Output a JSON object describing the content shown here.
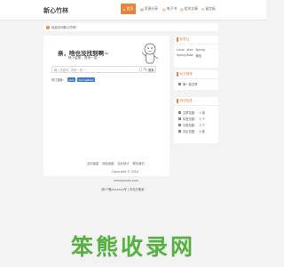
{
  "header": {
    "logo": "新心竹林",
    "nav": [
      {
        "label": "首页",
        "icon": "home-icon"
      },
      {
        "label": "资源分享",
        "icon": "share-icon"
      },
      {
        "label": "电子书",
        "icon": "book-icon"
      },
      {
        "label": "相关文章",
        "icon": "article-icon"
      },
      {
        "label": "留言板",
        "icon": "message-icon"
      }
    ]
  },
  "notice": {
    "text": "欢迎访问新心竹林！"
  },
  "hero": {
    "title": "亲，啥也没找到啊~",
    "subtitle": "换个姿势，再来一发~",
    "search_placeholder": "输入关键词，再来一发~~",
    "search_button": "搜索",
    "hot_label": "热门搜索：",
    "hot_tags": [
      "Java",
      "SpringBoot"
    ]
  },
  "sidebar": {
    "tags_title": "标签云",
    "tags": [
      "Linux",
      "Java",
      "Spring",
      "Spring Boot",
      "微信"
    ],
    "recommend_title": "站长推荐",
    "recommend_items": [
      "第一篇文章"
    ],
    "stats_title": "网站信息",
    "stats": [
      {
        "label": "文章总数：",
        "value": "1 篇"
      },
      {
        "label": "标签总数：",
        "value": "5 个"
      },
      {
        "label": "分类总数：",
        "value": "2 个"
      },
      {
        "label": "评论总数：",
        "value": "0 条"
      }
    ]
  },
  "footer": {
    "links": [
      "友情链接",
      "网站地图",
      "站长统计",
      "联系我们"
    ],
    "copyright": "Copyright © 2024",
    "domain": "xinxinzhulin.com",
    "icp": "浙ICP备xxxxxxx号 | 本站已备案"
  },
  "watermark": "笨熊收录网",
  "colors": {
    "accent": "#e8843a",
    "tag_blue": "#3d7cc9",
    "watermark_green": "#55b13f"
  }
}
